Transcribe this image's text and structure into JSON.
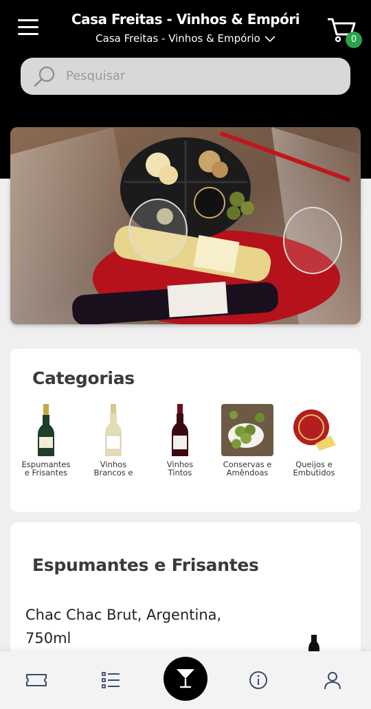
{
  "header": {
    "title": "Casa Freitas - Vinhos & Empóri",
    "store_select": "Casa Freitas - Vinhos & Empório",
    "cart_count": "0"
  },
  "search": {
    "placeholder": "Pesquisar"
  },
  "categories": {
    "title": "Categorias",
    "items": [
      {
        "line1": "Espumantes",
        "line2": "e Frisantes",
        "icon": "sparkling-wine-bottle"
      },
      {
        "line1": "Vinhos",
        "line2": "Brancos e",
        "icon": "white-wine-bottle"
      },
      {
        "line1": "Vinhos",
        "line2": "Tintos",
        "icon": "red-wine-bottle"
      },
      {
        "line1": "Conservas e",
        "line2": "Amêndoas",
        "icon": "olives-bowl"
      },
      {
        "line1": "Queijos e",
        "line2": "Embutidos",
        "icon": "cheese-wheel"
      }
    ]
  },
  "section": {
    "title": "Espumantes e Frisantes",
    "product_name": "Chac Chac Brut, Argentina, 750ml"
  },
  "colors": {
    "accent": "#2aa34a",
    "header": "#000000",
    "background": "#efefef"
  },
  "bottom_nav": [
    "ticket-icon",
    "list-icon",
    "cocktail-icon",
    "info-icon",
    "user-icon"
  ]
}
